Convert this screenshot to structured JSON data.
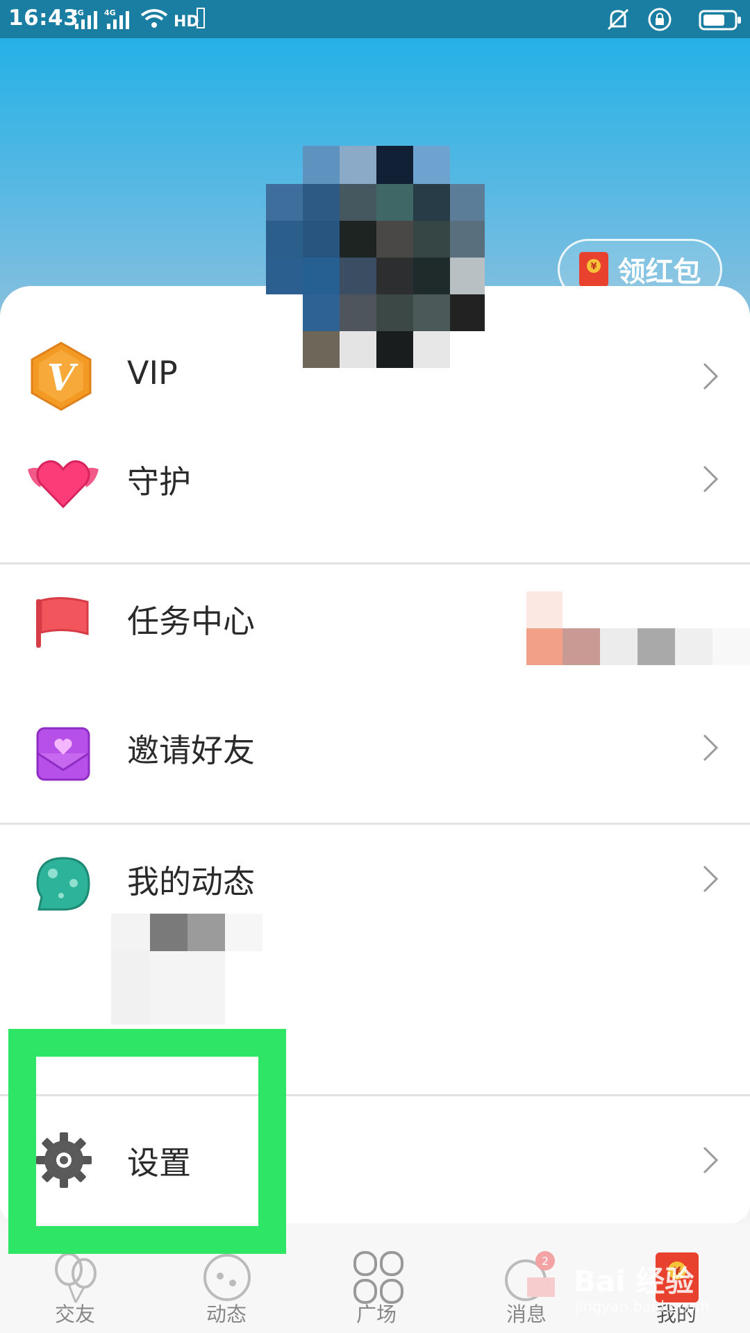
{
  "status_bar": {
    "time": "16:43",
    "network_1": "4G",
    "network_2": "4G",
    "hd_label": "HD"
  },
  "header": {
    "redpacket_label": "领红包"
  },
  "menu": {
    "items": [
      {
        "label": "VIP",
        "icon": "vip-badge-icon"
      },
      {
        "label": "守护",
        "icon": "winged-heart-icon"
      },
      {
        "label": "任务中心",
        "icon": "flag-icon"
      },
      {
        "label": "邀请好友",
        "icon": "envelope-heart-icon"
      },
      {
        "label": "我的动态",
        "icon": "planet-icon"
      },
      {
        "label": "设置",
        "icon": "gear-icon"
      }
    ]
  },
  "tabbar": {
    "tabs": [
      {
        "label": "交友",
        "icon": "balloons-icon"
      },
      {
        "label": "动态",
        "icon": "face-icon"
      },
      {
        "label": "广场",
        "icon": "grid-icon"
      },
      {
        "label": "消息",
        "icon": "chat-icon",
        "badge": "2"
      },
      {
        "label": "我的",
        "icon": "redpacket-icon"
      }
    ]
  },
  "watermark": {
    "text": "Bai 经验",
    "sub": "jingyan.baidu.com"
  },
  "colors": {
    "header_top": "#25b1e6",
    "highlight": "#2ee566",
    "accent_red": "#e84a3a"
  }
}
